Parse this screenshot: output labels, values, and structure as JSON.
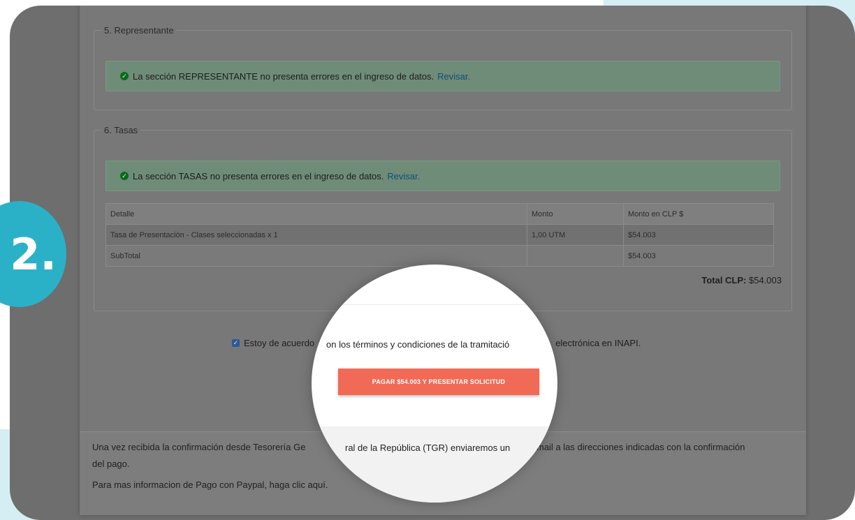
{
  "sections": {
    "representante": {
      "legend": "5. Representante",
      "alert_text": "La sección REPRESENTANTE no presenta errores en el ingreso de datos.",
      "alert_link": "Revisar."
    },
    "tasas": {
      "legend": "6. Tasas",
      "alert_text": "La sección TASAS no presenta errores en el ingreso de datos.",
      "alert_link": "Revisar.",
      "table": {
        "headers": [
          "Detalle",
          "Monto",
          "Monto en CLP $"
        ],
        "rows": [
          [
            "Tasa de Presentación - Clases seleccionadas x 1",
            "1,00 UTM",
            "$54.003"
          ],
          [
            "SubTotal",
            "",
            "$54.003"
          ]
        ]
      },
      "total_label": "Total CLP:",
      "total_value": "$54.003"
    }
  },
  "agreement": {
    "left_text": "Estoy de acuerdo",
    "right_text": "electrónica en INAPI.",
    "mag_text": "on los términos y condiciones de la tramitació"
  },
  "pay_button_label": "PAGAR $54.003 Y PRESENTAR SOLICITUD",
  "footer": {
    "line1_a": "Una vez recibida la confirmación desde Tesorería Ge",
    "line1_mag": "ral de la República (TGR) enviaremos un",
    "line1_b": "mail a las direcciones indicadas con la confirmación",
    "line2": "del pago.",
    "line3_a": "Para mas informacion de Pago con Paypal, haga clic aquí."
  },
  "step_badge": "2.",
  "colors": {
    "accent": "#2ab1c8",
    "pay_button": "#f06a55",
    "success_icon": "#0a6b1a"
  }
}
